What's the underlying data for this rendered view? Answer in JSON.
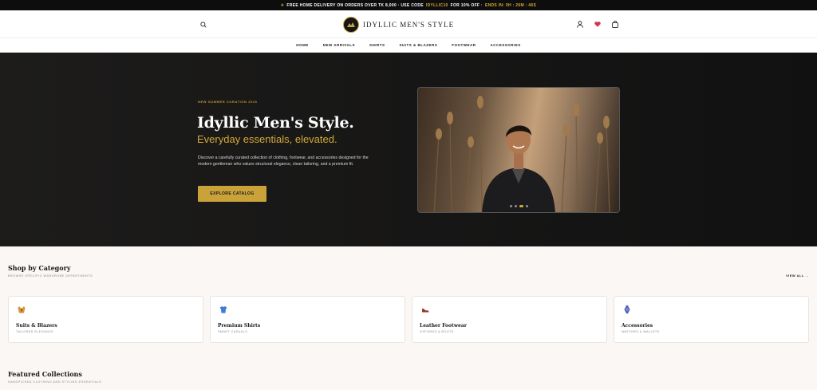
{
  "promo": {
    "icon": "plane-icon",
    "text_a": "FREE HOME DELIVERY ON ORDERS OVER TK 8,000 · USE CODE",
    "code": "IDYLLIC10",
    "text_b": "FOR 10% OFF ·",
    "countdown": "ENDS IN: 0H : 26M : 46S",
    "highlight_color": "#d4a936"
  },
  "header": {
    "brand": "IDYLLIC MEN'S STYLE",
    "icons": [
      "search-icon",
      "user-icon",
      "heart-icon",
      "bag-icon"
    ]
  },
  "nav": {
    "items": [
      "HOME",
      "NEW ARRIVALS",
      "SHIRTS",
      "SUITS & BLAZERS",
      "FOOTWEAR",
      "ACCESSORIES"
    ]
  },
  "hero": {
    "eyebrow": "NEW SUMMER CURATION 2026",
    "title": "Idyllic Men's Style.",
    "subtitle": "Everyday essentials, elevated.",
    "description": "Discover a carefully curated collection of clothing, footwear, and accessories designed for the modern gentleman who values structural elegance, clean tailoring, and a premium fit.",
    "cta": "EXPLORE CATALOG",
    "accent": "#c9a23a",
    "slides_total": 4,
    "slide_active": 2
  },
  "categories": {
    "title": "Shop by Category",
    "subtitle": "BROWSE SPECIFIC WARDROBE DEPARTMENTS",
    "view_all": "VIEW ALL",
    "items": [
      {
        "name": "Suits & Blazers",
        "sub": "TAILORED ELEGANCE",
        "icon": "suit-icon"
      },
      {
        "name": "Premium Shirts",
        "sub": "SMART CASUALS",
        "icon": "shirt-icon"
      },
      {
        "name": "Leather Footwear",
        "sub": "OXFORDS & BOOTS",
        "icon": "shoe-icon"
      },
      {
        "name": "Accessories",
        "sub": "WATCHES & WALLETS",
        "icon": "watch-icon"
      }
    ]
  },
  "featured": {
    "title": "Featured Collections",
    "subtitle": "HANDPICKED CLOTHING AND STYLING ESSENTIALS"
  }
}
